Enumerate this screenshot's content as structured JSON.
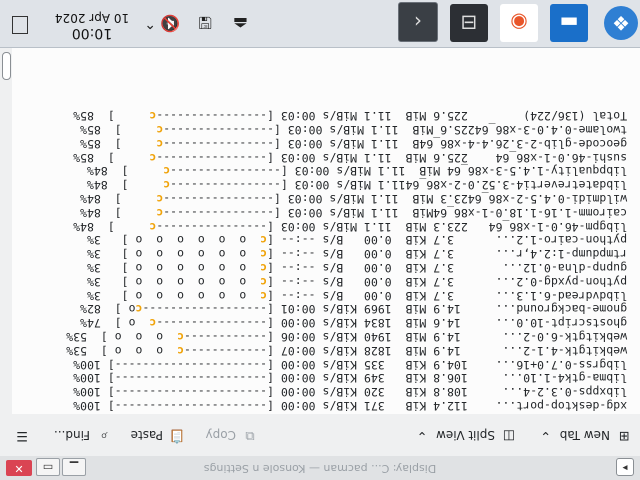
{
  "window": {
    "title": "pacman — Konsole",
    "title_partial": "Display: C...",
    "title_suffix": "n Settings",
    "close_glyph": "✕",
    "min_glyph": "▁",
    "max_glyph": "▭"
  },
  "toolbar": {
    "new_tab": "New Tab",
    "split_view": "Split View",
    "copy": "Copy",
    "paste": "Paste",
    "find": "Find..."
  },
  "terminal": {
    "lines": [
      [
        {
          "t": " xdg-desktop-port...    112.4 KiB   371 KiB/s 00:00 [----------------------] 100%"
        }
      ],
      [
        {
          "t": " libxpps-0.3.2-4...     108.8 KiB   320 KiB/s 00:00 [----------------------] 100%"
        }
      ],
      [
        {
          "t": " libma-gtk4-1.10...     106.8 KiB   349 KiB/s 00:00 [----------------------] 100%"
        }
      ],
      [
        {
          "t": " libgrss-0.7.0+16...    104.9 KiB   335 KiB/s 00:00 [----------------------] 100%"
        }
      ],
      [
        {
          "t": " webkitgtk-4.1-2...      14.9 MiB  1828 KiB/s 00:07 [------------"
        },
        {
          "t": "c",
          "c": "pac"
        },
        {
          "t": "  o  o  o ]  53%"
        }
      ],
      [
        {
          "t": " webkitgtk-6.0-2...      14.9 MiB  1940 KiB/s 00:06 [------------"
        },
        {
          "t": "c",
          "c": "pac"
        },
        {
          "t": "  o  o  o ]  53%"
        }
      ],
      [
        {
          "t": " ghostscript-10.0...     14.6 MiB  1834 KiB/s 00:00 [----------------"
        },
        {
          "t": "c",
          "c": "pac"
        },
        {
          "t": "  o ]  74%"
        }
      ],
      [
        {
          "t": " gnome-background...     14.9 MiB  1969 KiB/s 00:01 [------------------"
        },
        {
          "t": "c",
          "c": "pac"
        },
        {
          "t": "o ]  82%"
        }
      ],
      [
        {
          "t": " libdvdread-6.1.3...      3.7 KiB  0.00   B/s --:-- ["
        },
        {
          "t": "c",
          "c": "pac"
        },
        {
          "t": "  o  o  o  o  o  o ]   3%"
        }
      ],
      [
        {
          "t": " python-pyxdg-0.2...      3.7 KiB  0.00   B/s --:-- ["
        },
        {
          "t": "c",
          "c": "pac"
        },
        {
          "t": "  o  o  o  o  o  o ]   3%"
        }
      ],
      [
        {
          "t": " gupnp-dlna-0.12...       3.7 KiB  0.00   B/s --:-- ["
        },
        {
          "t": "c",
          "c": "pac"
        },
        {
          "t": "  o  o  o  o  o  o ]   3%"
        }
      ],
      [
        {
          "t": " rtmpdump-1:2.4,r...      3.7 KiB  0.00   B/s --:-- ["
        },
        {
          "t": "c",
          "c": "pac"
        },
        {
          "t": "  o  o  o  o  o  o ]   3%"
        }
      ],
      [
        {
          "t": " python-cairo-1.2...      3.7 KiB  0.00   B/s --:-- ["
        },
        {
          "t": "c",
          "c": "pac"
        },
        {
          "t": "  o  o  o  o  o  o ]   3%"
        }
      ],
      [
        {
          "t": " libgpm-46.0-1-x86_64   223.3 MiB  11.1 MiB/s 00:03 [----------------"
        },
        {
          "t": "c",
          "c": "pac"
        },
        {
          "t": "     ]  84%"
        }
      ],
      [
        {
          "t": " cairomm-1.16-1.18.0-1-x86_64MiB  11.1 MiB/s 00:03 [----------------"
        },
        {
          "t": "c",
          "c": "pac"
        },
        {
          "t": "     ]  84%"
        }
      ],
      [
        {
          "t": " wildmidi-0.4.5-2-x86_6423.3 MiB  11.1 MiB/s 00:03 [----------------"
        },
        {
          "t": "c",
          "c": "pac"
        },
        {
          "t": "     ]  84%"
        }
      ],
      [
        {
          "t": " libdatetreverti4-3.52.0-2-x86_6411.1 MiB/s 00:03 [----------------"
        },
        {
          "t": "c",
          "c": "pac"
        },
        {
          "t": "     ]  84%"
        }
      ],
      [
        {
          "t": " libpquality-1.4.5-3-x86_64 MiB  11.1 MiB/s 00:03 [----------------"
        },
        {
          "t": "c",
          "c": "pac"
        },
        {
          "t": "     ]  84%"
        }
      ],
      [
        {
          "t": " sushi-46.0-1-x86_64    225.6 MiB  11.1 MiB/s 00:03 [----------------"
        },
        {
          "t": "c",
          "c": "pac"
        },
        {
          "t": "     ]  85%"
        }
      ],
      [
        {
          "t": " geocode-glib-2-3.26.4-4-x86_64B  11.1 MiB/s 00:03 [----------------"
        },
        {
          "t": "c",
          "c": "pac"
        },
        {
          "t": "     ]  85%"
        }
      ],
      [
        {
          "t": " twolame-0.4.0-3-x86_6422S.6 MiB  11.1 MiB/s 00:03 [----------------"
        },
        {
          "t": "c",
          "c": "pac"
        },
        {
          "t": "     ]  85%"
        }
      ],
      [
        {
          "t": " Total (136/224)        225.6 MiB  11.1 MiB/s 00:03 [----------------"
        },
        {
          "t": "c",
          "c": "pac"
        },
        {
          "t": "     ]  85%"
        }
      ]
    ]
  },
  "taskbar": {
    "start_icon": "❖",
    "apps": [
      {
        "name": "app-icon-1",
        "glyph": "▬"
      },
      {
        "name": "app-icon-2",
        "glyph": "◉"
      },
      {
        "name": "app-icon-3",
        "glyph": "⊟"
      },
      {
        "name": "app-icon-4",
        "glyph": "‹"
      }
    ],
    "clock": {
      "time": "10:00",
      "date": "10 Apr 2024"
    },
    "tray": {
      "usb": "⏏",
      "network": "🖫",
      "volume": "🔇",
      "chevron": "⌃"
    }
  },
  "colors": {
    "pacman": "#f0a30a",
    "close": "#da4453",
    "start": "#2f7fd3"
  }
}
